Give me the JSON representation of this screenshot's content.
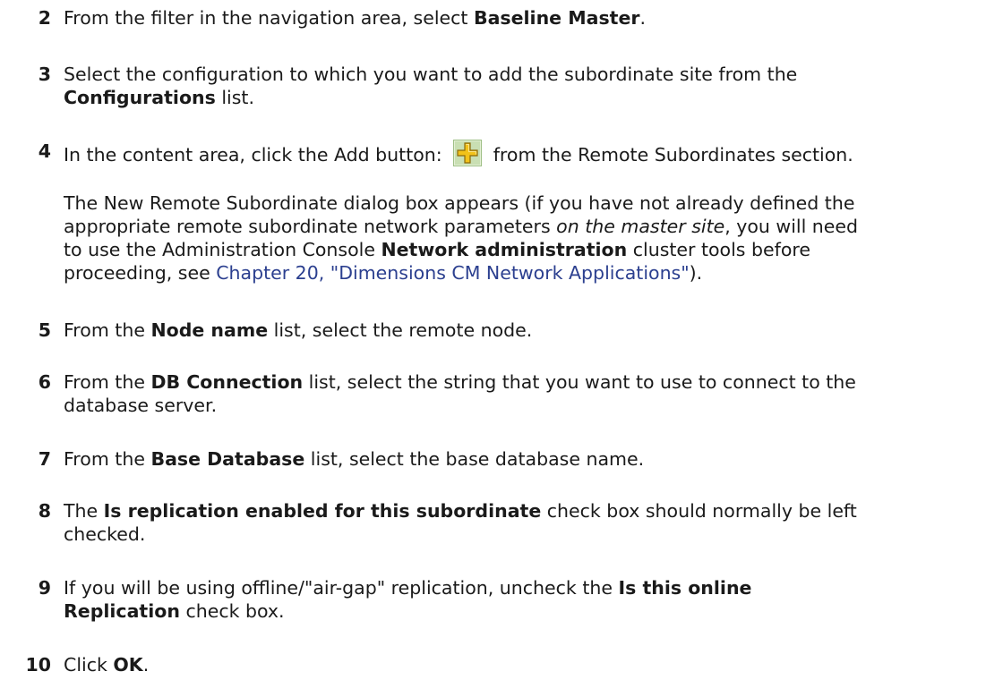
{
  "steps": {
    "s2": {
      "num": "2",
      "pre": "From the filter in the navigation area, select ",
      "b1": "Baseline Master",
      "post": "."
    },
    "s3": {
      "num": "3",
      "line1": "Select the configuration to which you want to add the subordinate site from the",
      "b1": "Configurations",
      "post": " list."
    },
    "s4": {
      "num": "4",
      "pre": "In the content area, click the Add button: ",
      "post": " from the Remote Subordinates section.",
      "icon": "add-plus-icon"
    },
    "s4_para": {
      "l1": "The New Remote Subordinate dialog box appears (if you have not already defined the",
      "l2a": "appropriate remote subordinate network parameters ",
      "l2i": "on the master site",
      "l2b": ", you will need",
      "l3a": "to use the Administration Console ",
      "l3b": "Network administration",
      "l3c": " cluster tools before",
      "l4a": "proceeding, see ",
      "l4link": "Chapter 20, \"Dimensions CM Network Applications\"",
      "l4b": ")."
    },
    "s5": {
      "num": "5",
      "pre": "From the ",
      "b1": "Node name",
      "post": " list, select the remote node."
    },
    "s6": {
      "num": "6",
      "pre": "From the ",
      "b1": "DB Connection",
      "post": " list, select the string that you want to use to connect to the",
      "line2": "database server."
    },
    "s7": {
      "num": "7",
      "pre": "From the ",
      "b1": "Base Database",
      "post": " list, select the base database name."
    },
    "s8": {
      "num": "8",
      "pre": "The ",
      "b1": "Is replication enabled for this subordinate",
      "post": " check box should normally be left",
      "line2": "checked."
    },
    "s9": {
      "num": "9",
      "pre": "If you will be using offline/\"air-gap\" replication, uncheck the ",
      "b1": "Is this online",
      "b2": "Replication",
      "post": " check box."
    },
    "s10": {
      "num": "10",
      "pre": "Click ",
      "b1": "OK",
      "post": "."
    }
  },
  "colors": {
    "text": "#1a1a1a",
    "link": "#2b3f8f",
    "icon_plus": "#e8b81a",
    "icon_bg": "#c9dfb3"
  }
}
